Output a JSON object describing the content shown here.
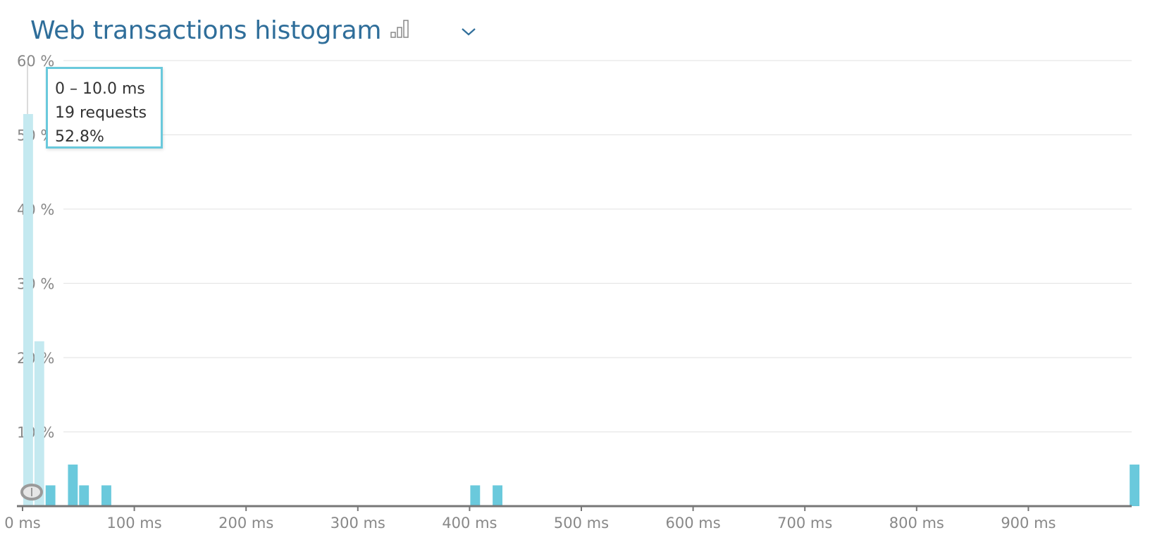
{
  "header": {
    "title": "Web transactions histogram",
    "chart_type_icon": "bar-chart-icon",
    "dropdown_icon": "chevron-down-icon"
  },
  "colors": {
    "title": "#2f6e9a",
    "bar": "#6ac9dc",
    "bar_highlight": "#c4e9f0",
    "axis": "#777777",
    "grid": "#e6e6e6",
    "tooltip_border": "#6ac9dc"
  },
  "tooltip": {
    "range": "0 – 10.0 ms",
    "requests": "19 requests",
    "percent": "52.8%"
  },
  "chart_data": {
    "type": "bar",
    "title": "Web transactions histogram",
    "xlabel": "",
    "ylabel": "",
    "x_unit": "ms",
    "y_unit": "%",
    "xlim": [
      0,
      1000
    ],
    "ylim": [
      0,
      60
    ],
    "grid": true,
    "bin_width_ms": 10,
    "x_ticks": [
      0,
      100,
      200,
      300,
      400,
      500,
      600,
      700,
      800,
      900
    ],
    "x_tick_labels": [
      "0 ms",
      "100 ms",
      "200 ms",
      "300 ms",
      "400 ms",
      "500 ms",
      "600 ms",
      "700 ms",
      "800 ms",
      "900 ms"
    ],
    "y_ticks": [
      10,
      20,
      30,
      40,
      50,
      60
    ],
    "y_tick_labels": [
      "10 %",
      "20 %",
      "30 %",
      "40 %",
      "50 %",
      "60 %"
    ],
    "bins": [
      {
        "start": 0,
        "end": 10,
        "value": 52.8,
        "highlight": true
      },
      {
        "start": 10,
        "end": 20,
        "value": 22.2,
        "highlight": true
      },
      {
        "start": 20,
        "end": 30,
        "value": 2.8
      },
      {
        "start": 40,
        "end": 50,
        "value": 5.6
      },
      {
        "start": 50,
        "end": 60,
        "value": 2.8
      },
      {
        "start": 70,
        "end": 80,
        "value": 2.8
      },
      {
        "start": 400,
        "end": 410,
        "value": 2.8
      },
      {
        "start": 420,
        "end": 430,
        "value": 2.8
      },
      {
        "start": 990,
        "end": 1000,
        "value": 5.6
      }
    ]
  }
}
